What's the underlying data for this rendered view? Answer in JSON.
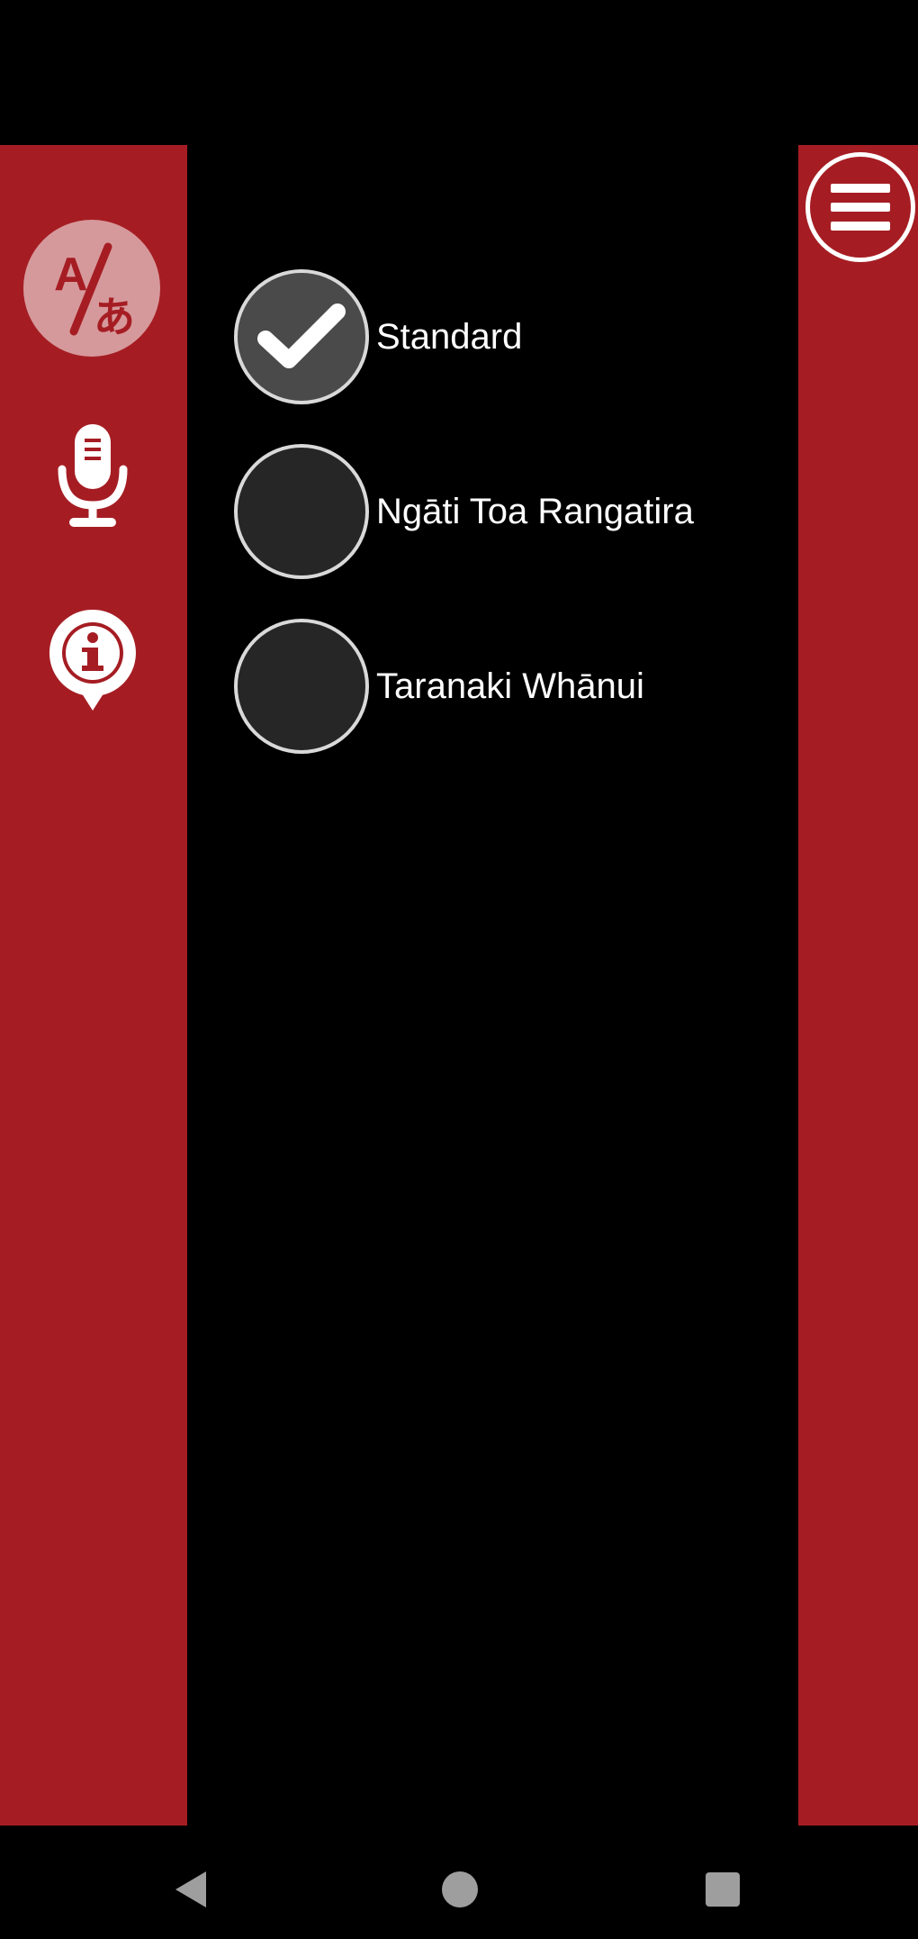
{
  "sidebar": {
    "translate_icon": "translate-icon",
    "mic_icon": "microphone-icon",
    "info_icon": "info-icon"
  },
  "menu": {
    "icon": "hamburger-menu-icon"
  },
  "dialect_options": [
    {
      "label": "Standard",
      "checked": true
    },
    {
      "label": "Ngāti Toa Rangatira",
      "checked": false
    },
    {
      "label": "Taranaki Whānui",
      "checked": false
    }
  ],
  "navbar": {
    "back_icon": "back-triangle-icon",
    "home_icon": "home-circle-icon",
    "recent_icon": "recent-apps-square-icon"
  },
  "colors": {
    "accent": "#a51d23",
    "background": "#000000",
    "radio_fill": "#262626",
    "radio_checked_fill": "#4a4a4a"
  }
}
